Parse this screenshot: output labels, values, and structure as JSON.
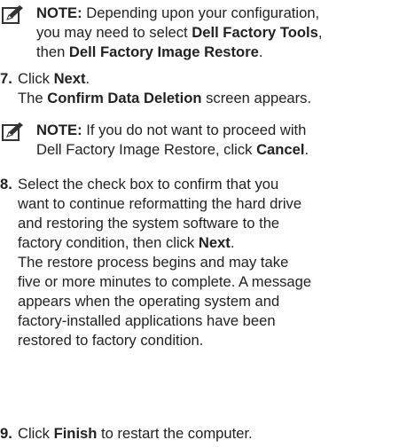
{
  "note1": {
    "label": "NOTE:",
    "icon": "pencil-note-icon",
    "lines": [
      [
        {
          "t": " Depending upon your configuration,"
        }
      ],
      [
        {
          "t": "you may need to select "
        },
        {
          "b": "Dell Factory Tools"
        },
        {
          "t": ","
        }
      ],
      [
        {
          "t": "then "
        },
        {
          "b": "Dell Factory Image Restore"
        },
        {
          "t": "."
        }
      ]
    ]
  },
  "step7": {
    "number": "7.",
    "lines": [
      [
        {
          "t": "Click "
        },
        {
          "b": "Next"
        },
        {
          "t": "."
        }
      ],
      [
        {
          "t": "The "
        },
        {
          "b": "Confirm Data Deletion"
        },
        {
          "t": " screen appears."
        }
      ]
    ]
  },
  "note2": {
    "label": "NOTE:",
    "icon": "pencil-note-icon",
    "lines": [
      [
        {
          "t": " If you do not want to proceed with"
        }
      ],
      [
        {
          "t": "Dell Factory Image Restore, click "
        },
        {
          "b": "Cancel"
        },
        {
          "t": "."
        }
      ]
    ]
  },
  "step8": {
    "number": "8.",
    "lines": [
      [
        {
          "t": "Select the check box to confirm that you"
        }
      ],
      [
        {
          "t": "want to continue reformatting the hard drive"
        }
      ],
      [
        {
          "t": "and restoring the system software to the"
        }
      ],
      [
        {
          "t": "factory condition, then click "
        },
        {
          "b": "Next"
        },
        {
          "t": "."
        }
      ],
      [
        {
          "t": "The restore process begins and may take"
        }
      ],
      [
        {
          "t": "five or more minutes to complete. A message"
        }
      ],
      [
        {
          "t": "appears when the operating system and"
        }
      ],
      [
        {
          "t": "factory-installed applications have been"
        }
      ],
      [
        {
          "t": "restored to factory condition."
        }
      ]
    ]
  },
  "step9": {
    "number": "9.",
    "lines": [
      [
        {
          "t": "Click "
        },
        {
          "b": "Finish"
        },
        {
          "t": " to restart the computer."
        }
      ]
    ]
  }
}
